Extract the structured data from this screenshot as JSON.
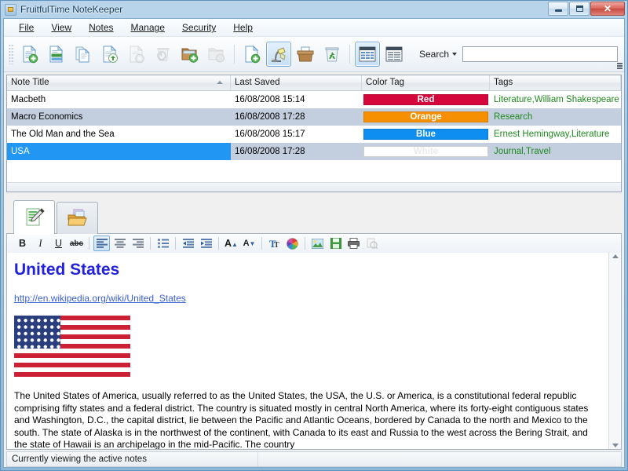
{
  "window": {
    "title": "FruitfulTime NoteKeeper",
    "app_icon": "notekeeper-icon",
    "buttons": {
      "minimize": "minimize",
      "maximize": "maximize",
      "close": "close"
    }
  },
  "menu": [
    {
      "label": "File",
      "accel": "F"
    },
    {
      "label": "View",
      "accel": "V"
    },
    {
      "label": "Notes",
      "accel": "N"
    },
    {
      "label": "Manage",
      "accel": "M"
    },
    {
      "label": "Security",
      "accel": "S"
    },
    {
      "label": "Help",
      "accel": "H"
    }
  ],
  "toolbar": {
    "buttons": [
      {
        "name": "new-note",
        "icon": "document-add-icon",
        "enabled": true,
        "active": false
      },
      {
        "name": "new-note-from-template",
        "icon": "document-template-icon",
        "enabled": true,
        "active": false
      },
      {
        "name": "copy-note",
        "icon": "documents-copy-icon",
        "enabled": true,
        "active": false
      },
      {
        "name": "restore-note",
        "icon": "document-recycle-icon",
        "enabled": true,
        "active": false
      },
      {
        "name": "delete-note",
        "icon": "document-delete-icon",
        "enabled": false,
        "active": false
      },
      {
        "name": "recycle-note",
        "icon": "recycle-back-icon",
        "enabled": false,
        "active": false
      },
      {
        "name": "new-folder",
        "icon": "folder-add-icon",
        "enabled": true,
        "active": false
      },
      {
        "name": "delete-folder",
        "icon": "folder-delete-icon",
        "enabled": false,
        "active": false
      },
      {
        "name": "new-page",
        "icon": "page-add-icon",
        "enabled": true,
        "active": false
      },
      {
        "name": "reminders",
        "icon": "desk-lamp-icon",
        "enabled": true,
        "active": true
      },
      {
        "name": "archive",
        "icon": "archive-box-icon",
        "enabled": true,
        "active": false
      },
      {
        "name": "recycle-bin",
        "icon": "recycle-bin-icon",
        "enabled": true,
        "active": false
      },
      {
        "name": "list-view",
        "icon": "list-view-icon",
        "enabled": true,
        "active": true
      },
      {
        "name": "detail-view",
        "icon": "detail-view-icon",
        "enabled": true,
        "active": false
      }
    ],
    "search_label": "Search",
    "search_value": "",
    "search_placeholder": ""
  },
  "note_list": {
    "columns": [
      {
        "label": "Note Title",
        "sorted": "asc"
      },
      {
        "label": "Last Saved",
        "sorted": ""
      },
      {
        "label": "Color Tag",
        "sorted": ""
      },
      {
        "label": "Tags",
        "sorted": ""
      }
    ],
    "rows": [
      {
        "title": "Macbeth",
        "last_saved": "16/08/2008 15:14",
        "color_tag": "Red",
        "color_hex": "#d4063b",
        "tag_text_color": "#ffffff",
        "tags": "Literature,William Shakespeare",
        "selected": false
      },
      {
        "title": "Macro Economics",
        "last_saved": "16/08/2008 17:28",
        "color_tag": "Orange",
        "color_hex": "#f79000",
        "tag_text_color": "#ffffff",
        "tags": "Research",
        "selected": false
      },
      {
        "title": "The Old Man and the Sea",
        "last_saved": "16/08/2008 15:17",
        "color_tag": "Blue",
        "color_hex": "#0d8ef0",
        "tag_text_color": "#ffffff",
        "tags": "Ernest Hemingway,Literature",
        "selected": false
      },
      {
        "title": "USA",
        "last_saved": "16/08/2008 17:28",
        "color_tag": "White",
        "color_hex": "#ffffff",
        "tag_text_color": "#f0f0f0",
        "tags": "Journal,Travel",
        "selected": true
      }
    ]
  },
  "editor": {
    "tabs": [
      {
        "name": "note-tab",
        "icon": "note-edit-icon",
        "active": true
      },
      {
        "name": "attachments-tab",
        "icon": "open-folder-icon",
        "active": false
      }
    ],
    "format_buttons": [
      {
        "name": "bold",
        "glyph": "B",
        "active": false
      },
      {
        "name": "italic",
        "glyph": "I",
        "active": false
      },
      {
        "name": "underline",
        "glyph": "U",
        "active": false
      },
      {
        "name": "strikethrough",
        "glyph": "abc",
        "active": false
      },
      {
        "name": "align-left",
        "glyph": "",
        "active": true
      },
      {
        "name": "align-center",
        "glyph": "",
        "active": false
      },
      {
        "name": "align-right",
        "glyph": "",
        "active": false
      },
      {
        "name": "bullet-list",
        "glyph": "",
        "active": false
      },
      {
        "name": "decrease-indent",
        "glyph": "",
        "active": false
      },
      {
        "name": "increase-indent",
        "glyph": "",
        "active": false
      },
      {
        "name": "increase-font-size",
        "glyph": "A",
        "active": false
      },
      {
        "name": "decrease-font-size",
        "glyph": "A",
        "active": false
      },
      {
        "name": "font",
        "glyph": "T",
        "active": false
      },
      {
        "name": "text-color",
        "glyph": "",
        "active": false
      },
      {
        "name": "insert-image",
        "glyph": "",
        "active": false
      },
      {
        "name": "save",
        "glyph": "",
        "active": false
      },
      {
        "name": "print",
        "glyph": "",
        "active": false
      },
      {
        "name": "print-preview",
        "glyph": "",
        "active": false
      }
    ],
    "content": {
      "heading": "United States",
      "heading_color": "#2222dd",
      "link": "http://en.wikipedia.org/wiki/United_States",
      "image": "united-states-flag",
      "paragraph": "The United States of America, usually referred to as the United States, the USA, the U.S. or America, is a constitutional federal republic comprising fifty states and a federal district. The country is situated mostly in central North America, where its forty-eight contiguous states and Washington, D.C., the capital district, lie between the Pacific and Atlantic Oceans, bordered by Canada to the north and Mexico to the south. The state of Alaska is in the northwest of the continent, with Canada to its east and Russia to the west across the Bering Strait, and the state of Hawaii is an archipelago in the mid-Pacific. The country"
    }
  },
  "status_bar": {
    "message": "Currently viewing the active notes"
  }
}
